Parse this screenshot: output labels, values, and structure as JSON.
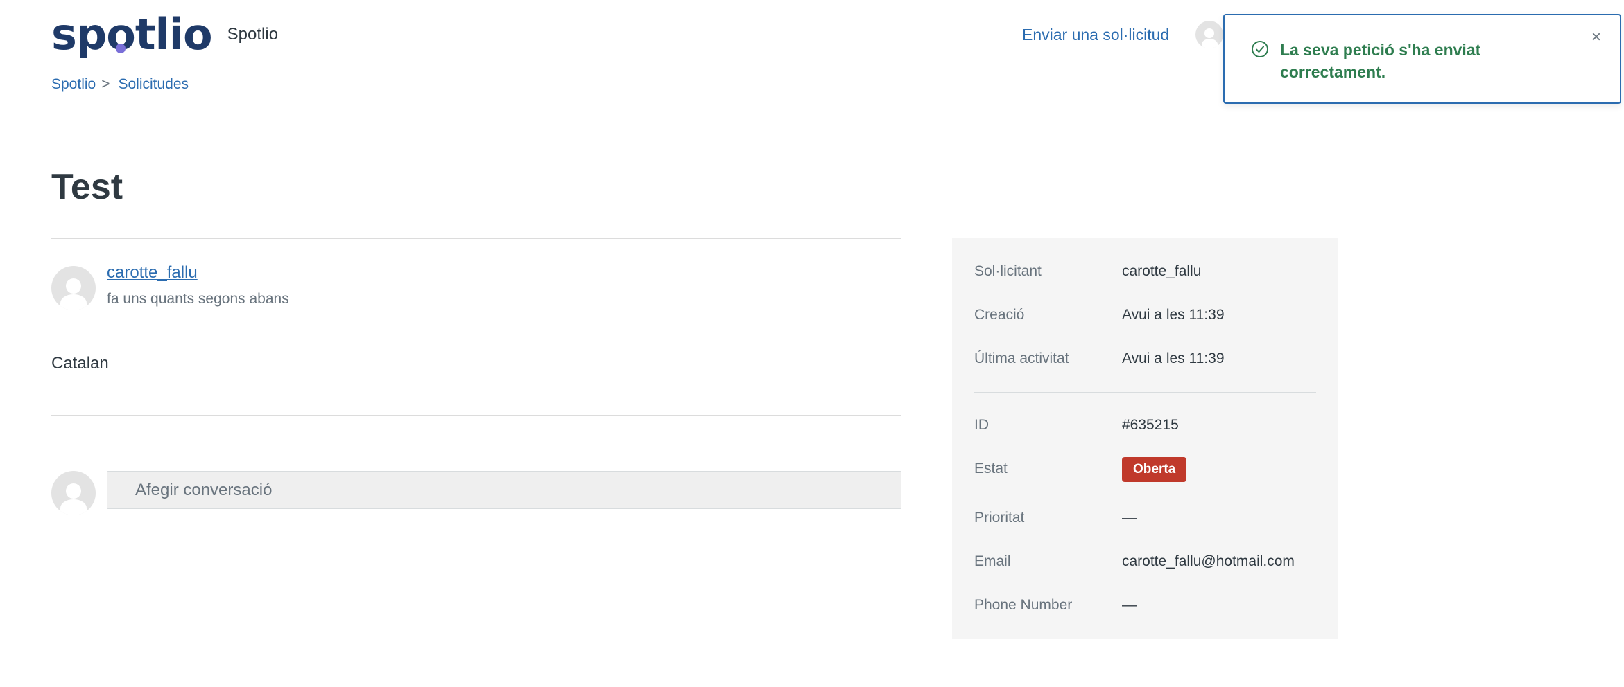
{
  "header": {
    "logo_parts": [
      "sp",
      "o",
      "tlio"
    ],
    "brand_name": "Spotlio",
    "submit_request": "Enviar una sol·licitud"
  },
  "breadcrumb": {
    "items": [
      "Spotlio",
      "Solicitudes"
    ],
    "separator": ">"
  },
  "request": {
    "title": "Test",
    "author": "carotte_fallu",
    "time": "fa uns quants segons abans",
    "body": "Catalan",
    "add_conversation": "Afegir conversació"
  },
  "details": {
    "requester_label": "Sol·licitant",
    "requester": "carotte_fallu",
    "created_label": "Creació",
    "created": "Avui a les 11:39",
    "last_activity_label": "Última activitat",
    "last_activity": "Avui a les 11:39",
    "id_label": "ID",
    "id": "#635215",
    "status_label": "Estat",
    "status": "Oberta",
    "priority_label": "Prioritat",
    "priority": "—",
    "email_label": "Email",
    "email": "carotte_fallu@hotmail.com",
    "phone_label": "Phone Number",
    "phone": "—"
  },
  "toast": {
    "message": "La seva petició s'ha enviat correctament.",
    "icon": "check-circle-icon",
    "close": "×"
  },
  "colors": {
    "brand": "#1f3a68",
    "brand_dot": "#7a6fd8",
    "link": "#2b6cb0",
    "status_open": "#c0392b",
    "success": "#2e7d4f"
  }
}
